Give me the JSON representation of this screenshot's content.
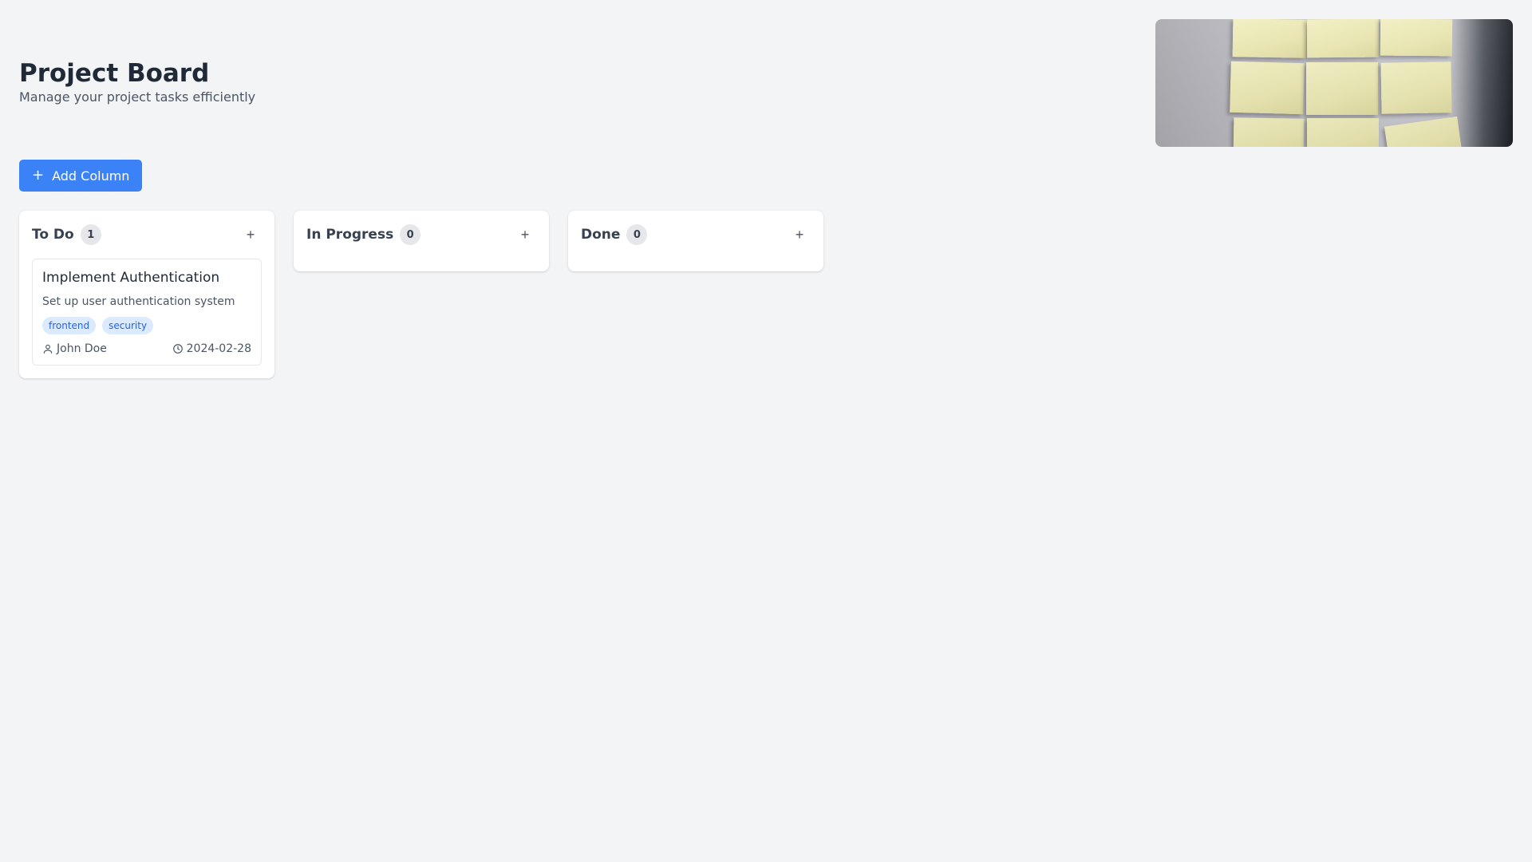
{
  "header": {
    "title": "Project Board",
    "subtitle": "Manage your project tasks efficiently"
  },
  "toolbar": {
    "add_column_icon": "plus-icon",
    "add_column_label": "Add Column"
  },
  "columns": [
    {
      "title": "To Do",
      "count": "1",
      "add_icon": "plus-icon",
      "cards": [
        {
          "title": "Implement Authentication",
          "description": "Set up user authentication system",
          "tags": [
            "frontend",
            "security"
          ],
          "assignee_icon": "user-icon",
          "assignee": "John Doe",
          "due_icon": "clock-icon",
          "due_date": "2024-02-28"
        }
      ]
    },
    {
      "title": "In Progress",
      "count": "0",
      "add_icon": "plus-icon",
      "cards": []
    },
    {
      "title": "Done",
      "count": "0",
      "add_icon": "plus-icon",
      "cards": []
    }
  ],
  "colors": {
    "background": "#f3f4f6",
    "accent": "#3b82f6",
    "tag_background": "#dbeafe",
    "tag_text": "#2563eb"
  }
}
